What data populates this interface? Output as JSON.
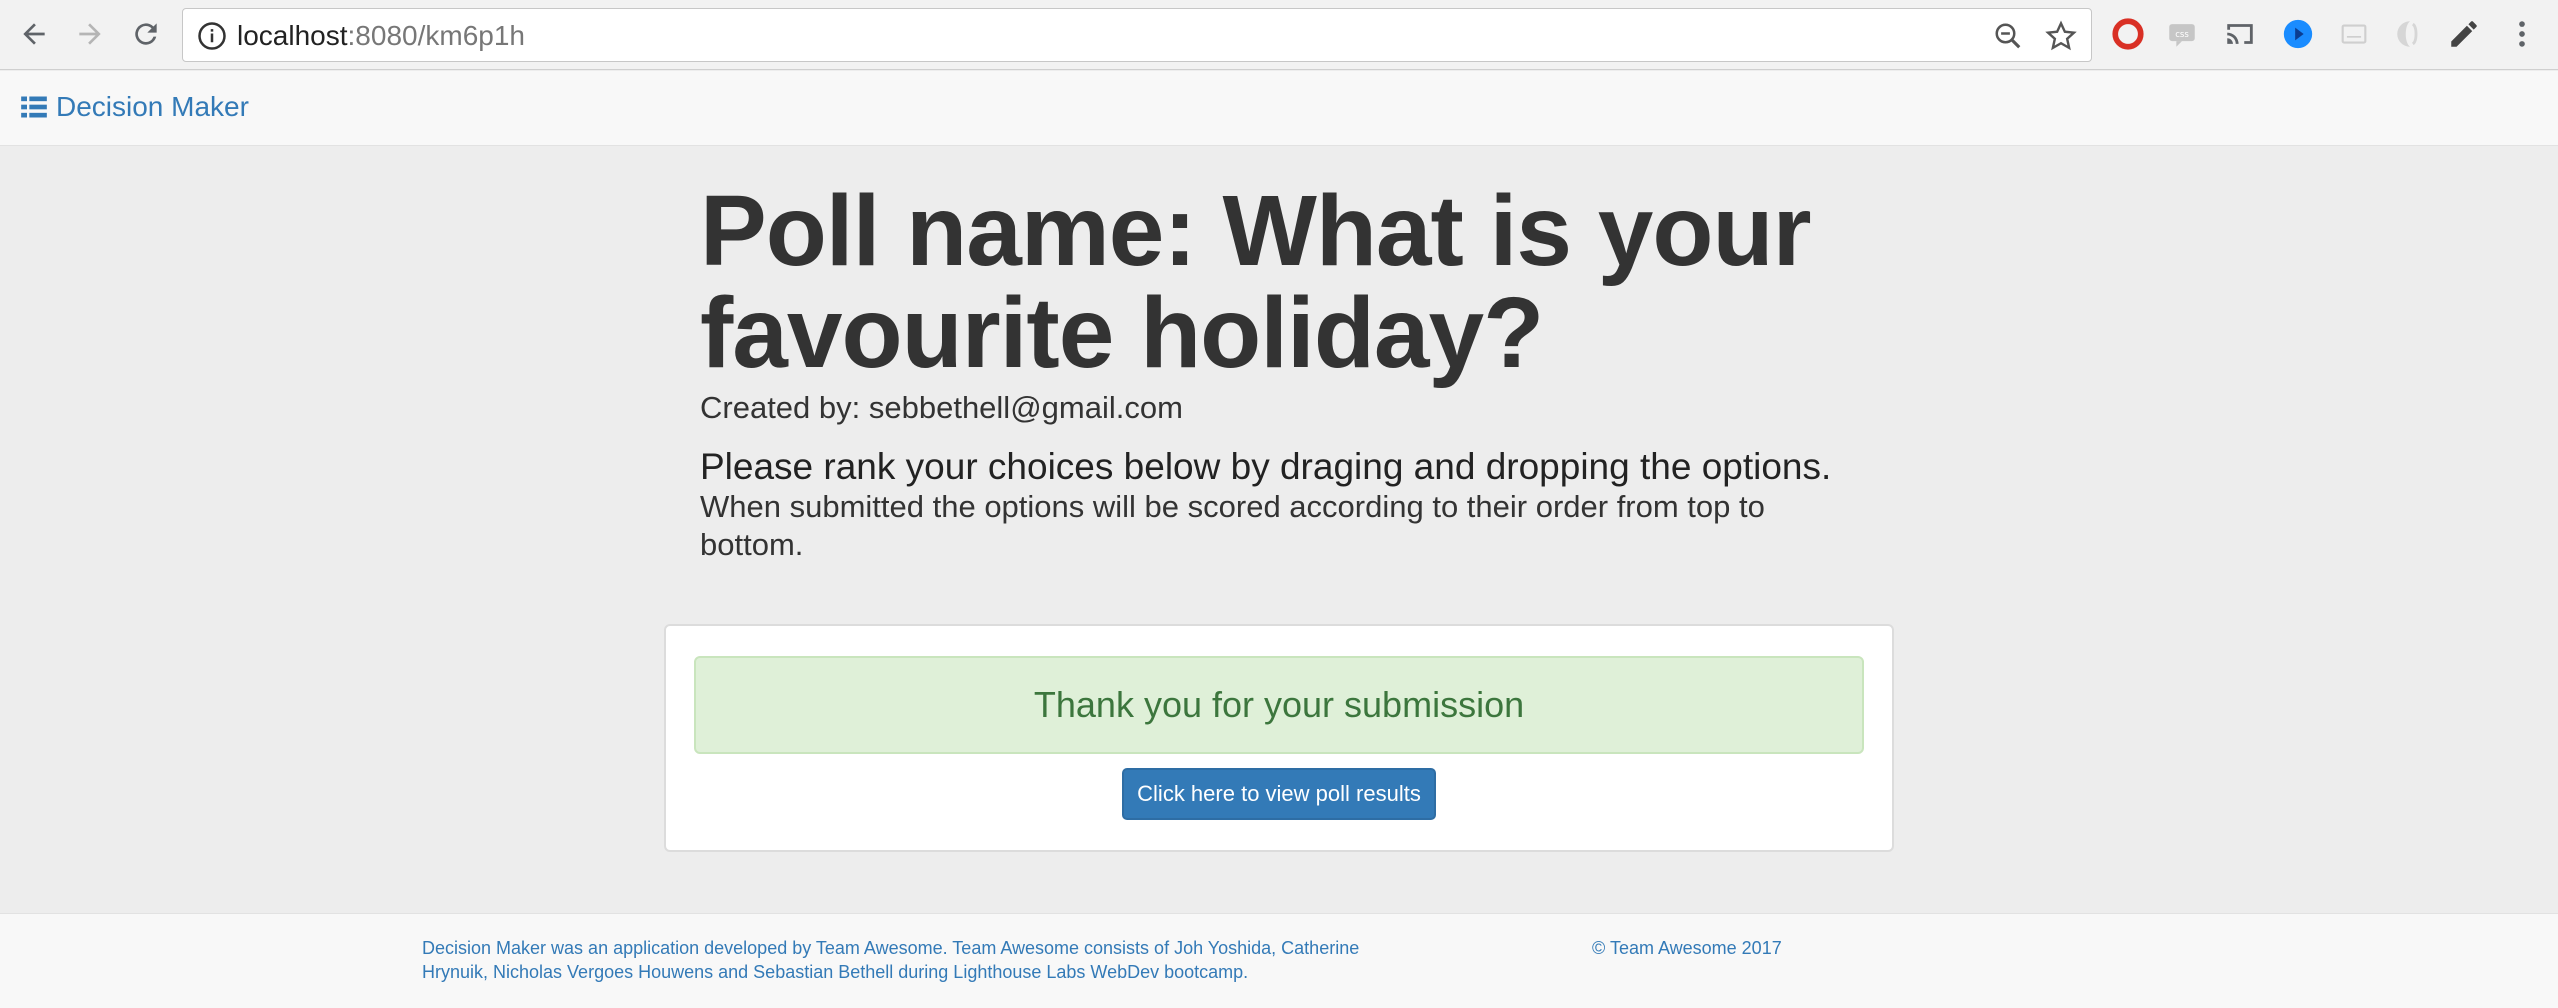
{
  "browser": {
    "url_host": "localhost",
    "url_rest": ":8080/km6p1h",
    "icons": [
      "back-icon",
      "forward-icon",
      "reload-icon",
      "info-icon",
      "zoom-icon",
      "star-icon"
    ],
    "extensions": [
      "opera-icon",
      "css-icon",
      "cast-icon",
      "play-icon",
      "window-icon",
      "extension-icon",
      "pencil-icon",
      "menu-icon"
    ]
  },
  "navbar": {
    "brand": "Decision Maker",
    "brand_icon": "list-icon"
  },
  "main": {
    "title": "Poll name: What is your favourite holiday?",
    "creator": "Created by: sebbethell@gmail.com",
    "instructions": "Please rank your choices below by draging and dropping the options.",
    "note": "When submitted the options will be scored according to their order from top to bottom."
  },
  "panel": {
    "alert": "Thank you for your submission",
    "button": "Click here to view poll results"
  },
  "footer": {
    "text": "Decision Maker was an application developed by Team Awesome. Team Awesome consists of Joh Yoshida, Catherine Hrynuik, Nicholas Vergoes Houwens and Sebastian Bethell during Lighthouse Labs WebDev bootcamp.",
    "copyright": "© Team Awesome 2017"
  },
  "colors": {
    "link": "#337ab7",
    "alert_bg": "#dff0d8",
    "alert_text": "#3c763d",
    "page_bg": "#ededed"
  }
}
